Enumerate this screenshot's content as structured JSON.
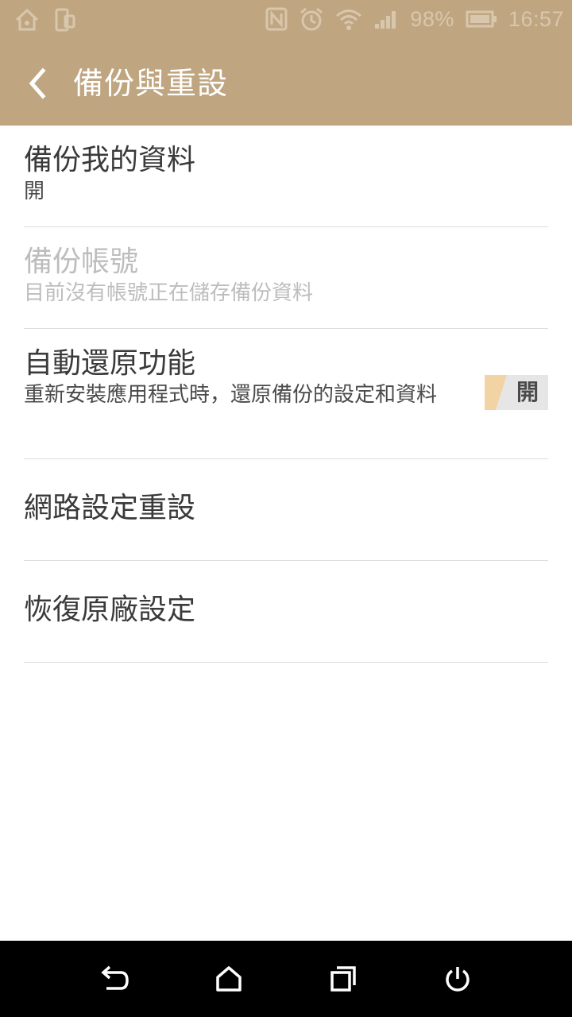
{
  "status_bar": {
    "battery": "98%",
    "time": "16:57"
  },
  "header": {
    "title": "備份與重設"
  },
  "items": [
    {
      "title": "備份我的資料",
      "summary": "開"
    },
    {
      "title": "備份帳號",
      "summary": "目前沒有帳號正在儲存備份資料",
      "enabled": false
    },
    {
      "title": "自動還原功能",
      "summary": "重新安裝應用程式時，還原備份的設定和資料",
      "toggle_label": "開"
    },
    {
      "title": "網路設定重設"
    },
    {
      "title": "恢復原廠設定"
    }
  ],
  "colors": {
    "accent": "#bfa580",
    "toggle_on": "#f2d4a4"
  }
}
